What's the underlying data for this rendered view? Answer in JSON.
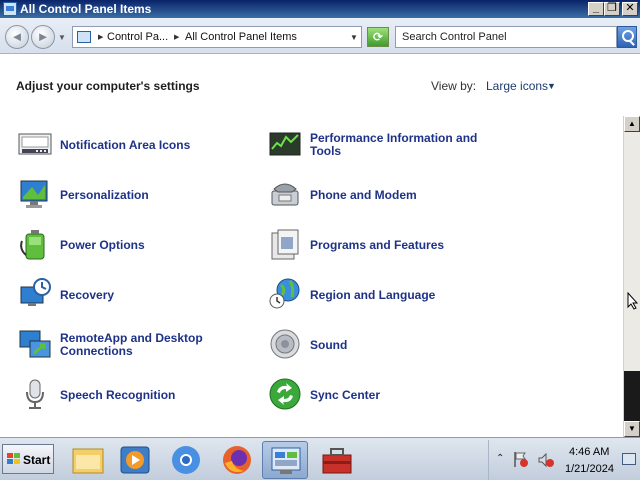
{
  "window": {
    "title": "All Control Panel Items",
    "min_glyph": "_",
    "max_glyph": "❐",
    "close_glyph": "✕"
  },
  "address": {
    "back_glyph": "◄",
    "forward_glyph": "►",
    "crumbs": [
      "Control Pa...",
      "All Control Panel Items"
    ],
    "search_placeholder": "Search Control Panel"
  },
  "content": {
    "heading": "Adjust your computer's settings",
    "view_by_label": "View by:",
    "view_by_value": "Large icons"
  },
  "items_left": [
    {
      "label": "Notification Area Icons",
      "icon": "notification-area-icon"
    },
    {
      "label": "Personalization",
      "icon": "personalization-icon"
    },
    {
      "label": "Power Options",
      "icon": "power-options-icon"
    },
    {
      "label": "Recovery",
      "icon": "recovery-icon"
    },
    {
      "label": "RemoteApp and Desktop Connections",
      "icon": "remoteapp-icon"
    },
    {
      "label": "Speech Recognition",
      "icon": "microphone-icon"
    }
  ],
  "items_right": [
    {
      "label": "Performance Information and Tools",
      "icon": "performance-icon"
    },
    {
      "label": "Phone and Modem",
      "icon": "phone-modem-icon"
    },
    {
      "label": "Programs and Features",
      "icon": "programs-features-icon"
    },
    {
      "label": "Region and Language",
      "icon": "globe-icon"
    },
    {
      "label": "Sound",
      "icon": "speaker-icon"
    },
    {
      "label": "Sync Center",
      "icon": "sync-center-icon"
    }
  ],
  "taskbar": {
    "start_label": "Start",
    "apps": [
      {
        "name": "explorer-icon"
      },
      {
        "name": "media-player-icon"
      },
      {
        "name": "chrome-icon"
      },
      {
        "name": "firefox-icon"
      },
      {
        "name": "control-panel-icon",
        "active": true
      },
      {
        "name": "toolbox-icon"
      }
    ],
    "time": "4:46 AM",
    "date": "1/21/2024"
  },
  "colors": {
    "link": "#1e3287",
    "titlebar": "#0a246a"
  }
}
